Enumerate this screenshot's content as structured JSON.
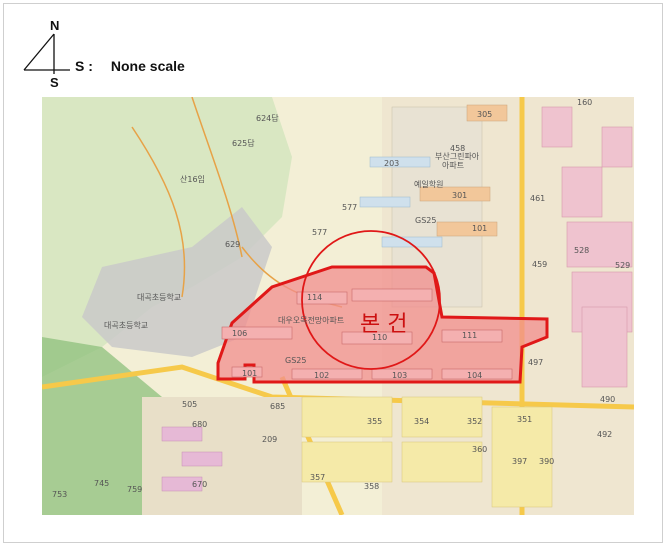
{
  "compass": {
    "north": "N",
    "south": "S"
  },
  "scale": {
    "prefix": "S :",
    "text": "None scale"
  },
  "site_label": "본 건",
  "labels": {
    "l160": "160",
    "l305": "305",
    "l458": "458",
    "busan_green": "부산그린파아",
    "apt_green": "아파트",
    "l203": "203",
    "yeil": "예일학원",
    "l301": "301",
    "l461": "461",
    "l528": "528",
    "l529": "529",
    "l459": "459",
    "gs25_top": "GS25",
    "l101": "101",
    "bunji577": "577",
    "l577": "577",
    "l624": "624답",
    "l625": "625답",
    "l616": "산16임",
    "l629": "629",
    "school": "대곡초등학교",
    "school2": "대곡초등학교",
    "l114": "114",
    "l106": "106",
    "l110": "110",
    "l111": "111",
    "l101b": "101",
    "l102": "102",
    "l103": "103",
    "l104": "104",
    "l497": "497",
    "gs25_mid": "GS25",
    "l685": "685",
    "l209": "209",
    "l355": "355",
    "l354": "354",
    "l352": "352",
    "l351": "351",
    "l360": "360",
    "l390": "390",
    "l397": "397",
    "l492": "492",
    "l490": "490",
    "l745": "745",
    "l759": "759",
    "l753": "753",
    "l358": "358",
    "l357": "357",
    "l680": "680",
    "l670": "670",
    "l505": "505",
    "daemo_apt": "대우오목전망아파트"
  }
}
